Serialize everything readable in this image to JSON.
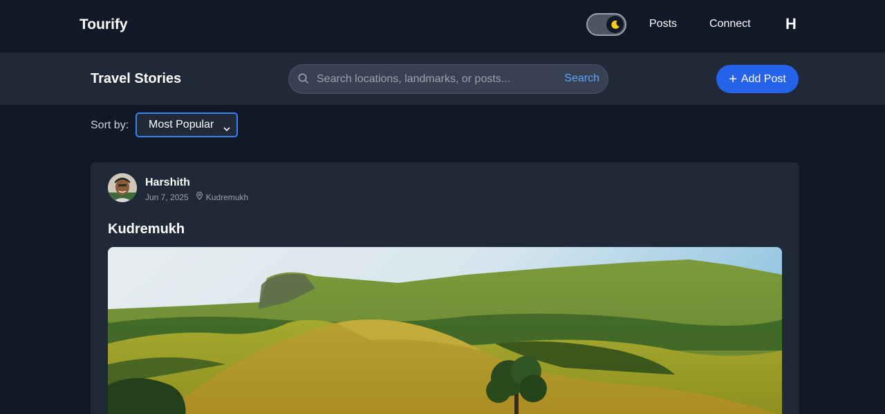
{
  "nav": {
    "brand": "Tourify",
    "links": [
      "Posts",
      "Connect"
    ],
    "avatar_letter": "H",
    "theme_toggle_icon": "moon-icon"
  },
  "subheader": {
    "title": "Travel Stories",
    "search": {
      "placeholder": "Search locations, landmarks, or posts...",
      "value": "",
      "button_label": "Search"
    },
    "add_post_label": "Add Post"
  },
  "sort": {
    "label": "Sort by:",
    "selected": "Most Popular"
  },
  "post": {
    "author": "Harshith",
    "date": "Jun 7, 2025",
    "location": "Kudremukh",
    "title": "Kudremukh"
  },
  "colors": {
    "background": "#111827",
    "surface": "#1f2937",
    "accent": "#2563eb",
    "link": "#60a5fa",
    "moon": "#facc15"
  }
}
